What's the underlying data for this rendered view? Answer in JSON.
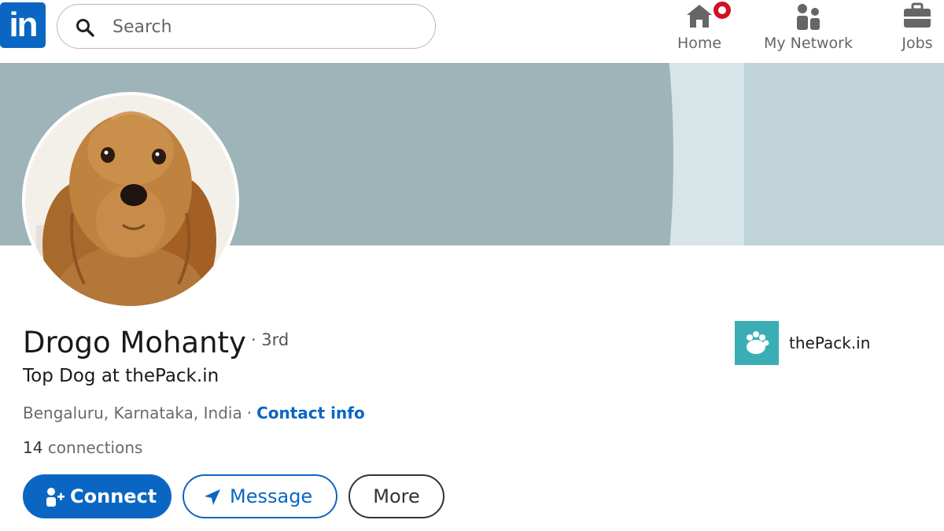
{
  "nav": {
    "logo_text": "in",
    "search": {
      "placeholder": "Search",
      "value": ""
    },
    "items": [
      {
        "label": "Home",
        "icon": "home-icon",
        "has_notification": true
      },
      {
        "label": "My Network",
        "icon": "people-icon"
      },
      {
        "label": "Jobs",
        "icon": "briefcase-icon"
      }
    ]
  },
  "profile": {
    "name": "Drogo Mohanty",
    "degree": "· 3rd",
    "headline": "Top Dog at thePack.in",
    "location": "Bengaluru, Karnataka, India",
    "separator": "·",
    "contact_info_label": "Contact info",
    "connections_count": "14",
    "connections_label": "connections",
    "avatar_icon": "dog-photo"
  },
  "company": {
    "name": "thePack.in",
    "logo_icon": "paw-logo-icon"
  },
  "actions": {
    "connect_label": "Connect",
    "message_label": "Message",
    "more_label": "More"
  },
  "colors": {
    "brand_blue": "#0a66c2",
    "notification_red": "#d11124",
    "banner_primary": "#9fb4b9",
    "banner_light": "#d7e4e8",
    "banner_right": "#bfd3d8",
    "company_logo_bg": "#3aaeb4"
  }
}
